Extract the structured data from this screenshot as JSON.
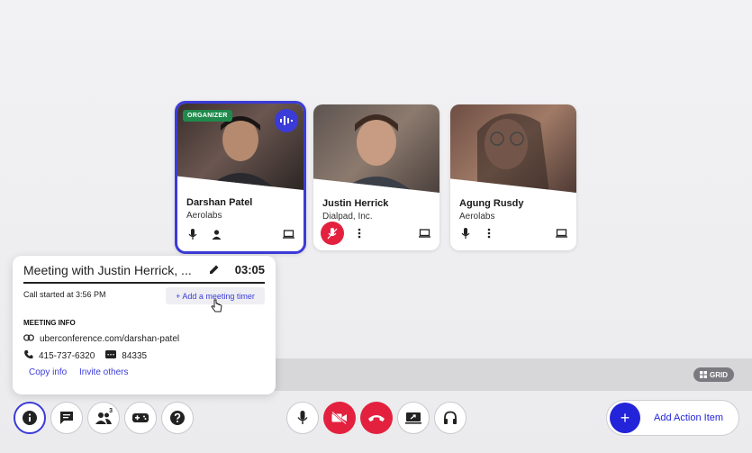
{
  "participants": [
    {
      "name": "Darshan Patel",
      "org": "Aerolabs",
      "badge": "ORGANIZER",
      "photo_color": "#4a3a36"
    },
    {
      "name": "Justin Herrick",
      "org": "Dialpad, Inc.",
      "photo_color": "#6a5a52"
    },
    {
      "name": "Agung Rusdy",
      "org": "Aerolabs",
      "photo_color": "#7a5a4e"
    }
  ],
  "view": {
    "grid_label": "GRID"
  },
  "meeting": {
    "title": "Meeting with Justin Herrick, ...",
    "elapsed": "03:05",
    "started": "Call started at 3:56 PM",
    "timer_button": "+ Add a meeting timer",
    "section_label": "MEETING INFO",
    "url_prefix": "uberconference.com/",
    "url_slug": "darshan-patel",
    "phone": "415-737-6320",
    "pin": "84335",
    "copy_label": "Copy info",
    "invite_label": "Invite others"
  },
  "toolbar": {
    "participant_count": "3",
    "action_item_label": "Add Action Item",
    "action_plus": "+"
  },
  "colors": {
    "accent": "#3b3bd9",
    "danger": "#e3213f",
    "organizer": "#1f8a4c"
  }
}
